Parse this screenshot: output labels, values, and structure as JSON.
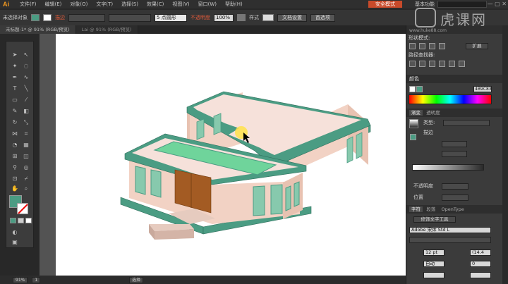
{
  "app": {
    "logo": "Ai"
  },
  "menu": {
    "items": [
      "文件(F)",
      "编辑(E)",
      "对象(O)",
      "文字(T)",
      "选择(S)",
      "效果(C)",
      "视图(V)",
      "窗口(W)",
      "帮助(H)"
    ]
  },
  "topbar": {
    "workspace_button": "安全模式",
    "workspace_mode": "基本功能",
    "window_controls": "— ▢ ✕"
  },
  "controlbar": {
    "selection_label": "未选择对象",
    "stroke_label": "描边",
    "brush_value": "5 点圆形",
    "opacity_label": "不透明度",
    "opacity_value": "100%",
    "style_label": "样式",
    "doc_setup_button": "文档设置",
    "preferences_button": "首选项"
  },
  "tabs": [
    {
      "label": "未标题-1* @ 91% (RGB/预览)",
      "active": true
    },
    {
      "label": "Lai @ 91% (RGB/预览)",
      "active": false
    }
  ],
  "colors": {
    "fill": "#4b9c83",
    "roof_top": "#f6e1da",
    "roof_edge": "#4b9c83",
    "wall": "#f2d2c4",
    "wall_shade": "#e8c2b1",
    "window": "#87c9ad",
    "door": "#a35b23",
    "steps": "#d7b9ad",
    "pool": "#6fd49b"
  },
  "panels": {
    "shape_modes_title": "形状模式:",
    "expand_button": "扩展",
    "pathfinder_title": "路径查找器:",
    "color_tab": "颜色",
    "hex_value": "4B9C83",
    "gradient_tab": "渐变",
    "transparency_tab": "透明度",
    "type_label": "类型:",
    "stroke_label": "描边",
    "opacity_label": "不透明度",
    "position_label": "位置",
    "char_tabs": [
      "字符",
      "段落",
      "OpenType"
    ],
    "touch_type_button": "修饰文字工具",
    "font_name": "Adobe 宋体 Std L",
    "font_size": "12 pt",
    "leading": "(14.4",
    "kerning": "自动",
    "tracking": "0"
  },
  "watermark": {
    "brand": "虎课网",
    "url": "www.huke88.com"
  },
  "statusbar": {
    "zoom": "91%",
    "page": "1",
    "tool": "选择"
  }
}
